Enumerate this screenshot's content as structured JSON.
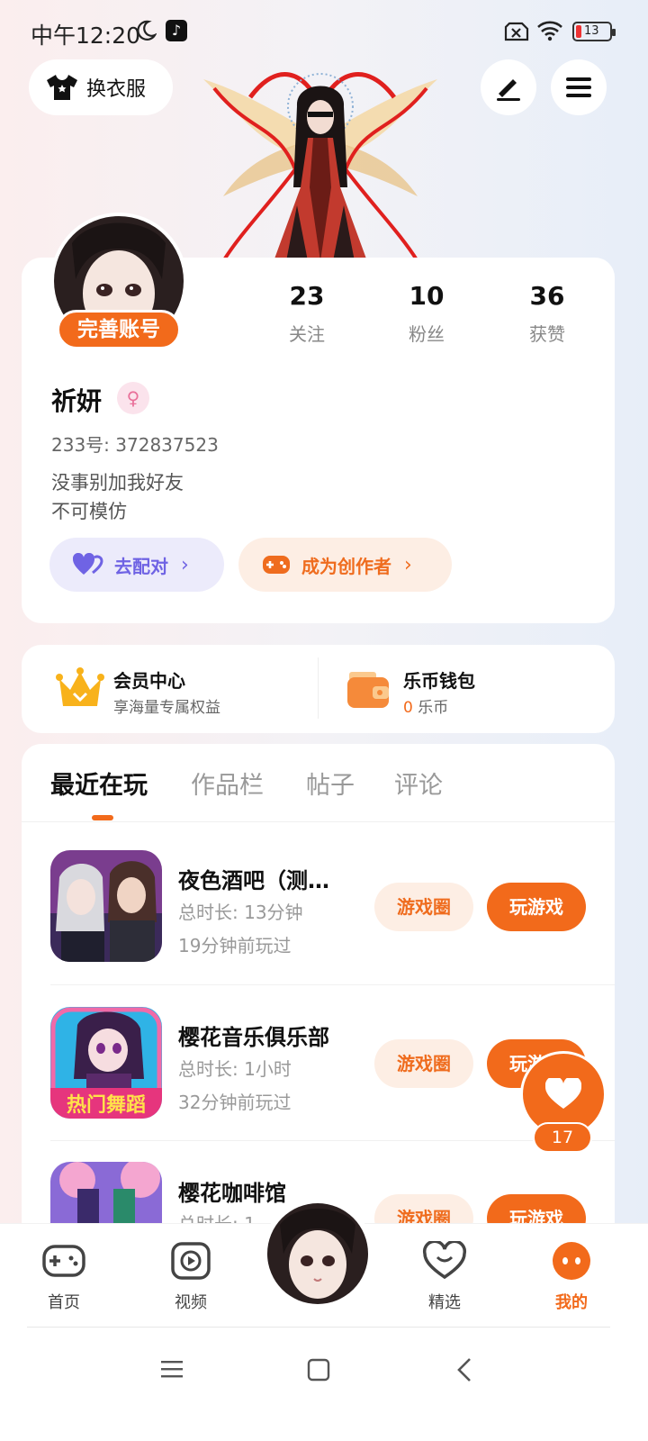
{
  "status_bar": {
    "time": "中午12:20",
    "battery": "13"
  },
  "header": {
    "outfit_label": "换衣服"
  },
  "profile": {
    "complete_badge": "完善账号",
    "stats": [
      {
        "num": "23",
        "label": "关注"
      },
      {
        "num": "10",
        "label": "粉丝"
      },
      {
        "num": "36",
        "label": "获赞"
      }
    ],
    "username": "祈妍",
    "gender_symbol": "♀",
    "user_id": "233号: 372837523",
    "bio_line1": "没事别加我好友",
    "bio_line2": "不可模仿",
    "pair_label": "去配对",
    "creator_label": "成为创作者"
  },
  "member": {
    "vip_title": "会员中心",
    "vip_sub": "享海量专属权益",
    "wallet_title": "乐币钱包",
    "wallet_amount": "0",
    "wallet_unit": " 乐币"
  },
  "tabs": [
    "最近在玩",
    "作品栏",
    "帖子",
    "评论"
  ],
  "games": [
    {
      "title": "夜色酒吧（测…",
      "duration": "总时长: 13分钟",
      "last_played": "19分钟前玩过",
      "circle": "游戏圈",
      "play": "玩游戏"
    },
    {
      "title": "樱花音乐俱乐部",
      "duration": "总时长: 1小时",
      "last_played": "32分钟前玩过",
      "circle": "游戏圈",
      "play": "玩游戏",
      "icon_text": "热门舞蹈"
    },
    {
      "title": "樱花咖啡馆",
      "duration": "总时长: 1…",
      "circle": "游戏圈",
      "play": "玩游戏"
    }
  ],
  "float_heart": {
    "count": "17"
  },
  "bottom_nav": [
    {
      "label": "首页",
      "icon": "gamepad-icon"
    },
    {
      "label": "视频",
      "icon": "video-play-icon"
    },
    {
      "label": "精选",
      "icon": "heart-badge-icon"
    },
    {
      "label": "我的",
      "icon": "profile-face-icon"
    }
  ],
  "colors": {
    "accent": "#f26a1b",
    "pair": "#6f63e4",
    "creator_bg": "#fdeee4"
  }
}
